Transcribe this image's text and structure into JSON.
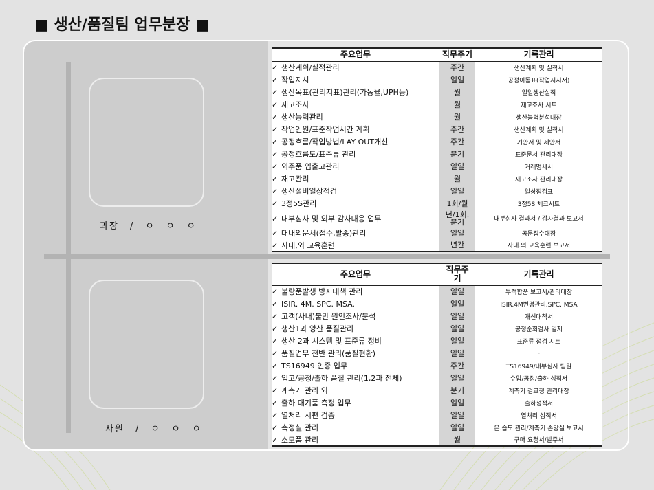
{
  "title": "■ 생산/품질팀 업무분장 ■",
  "headers": {
    "task": "주요업무",
    "cycle": "직무주기",
    "record": "기록관리"
  },
  "headers2": {
    "task": "주요업무",
    "cycle": "직무주기",
    "record": "기록관리"
  },
  "check": "✓",
  "manager": {
    "role": "과장 / ㅇ ㅇ ㅇ"
  },
  "staff": {
    "role": "사원 / ㅇ ㅇ ㅇ"
  },
  "manager_duties": [
    {
      "task": "생산계획/실적관리",
      "cycle": "주간",
      "record": "생산계획 및 실적서"
    },
    {
      "task": "작업지시",
      "cycle": "일일",
      "record": "공정이동표(작업지시서)"
    },
    {
      "task": "생산목표(관리지표)관리(가동율,UPH등)",
      "cycle": "월",
      "record": "일일생산실적"
    },
    {
      "task": "재고조사",
      "cycle": "월",
      "record": "재고조사 시트"
    },
    {
      "task": "생산능력관리",
      "cycle": "월",
      "record": "생산능력분석대장"
    },
    {
      "task": "작업인원/표준작업시간 계획",
      "cycle": "주간",
      "record": "생산계획 및 실적서"
    },
    {
      "task": "공정흐름/작업방법/LAY OUT개선",
      "cycle": "주간",
      "record": "기안서 및 제안서"
    },
    {
      "task": "공정흐름도/표준류 관리",
      "cycle": "분기",
      "record": "표준문서 관리대장"
    },
    {
      "task": "외주품 입출고관리",
      "cycle": "일일",
      "record": "거래명세서"
    },
    {
      "task": "재고관리",
      "cycle": "월",
      "record": "재고조사 관리대장"
    },
    {
      "task": "생산설비일상점검",
      "cycle": "일일",
      "record": "일상점검표"
    },
    {
      "task": "3정5S관리",
      "cycle": "1회/월",
      "record": "3정5S 체크시트"
    },
    {
      "task": "내부심사 및 외부 감사대응 업무",
      "cycle": "년/1회.\n분기",
      "record": "내부심사 결과서 / 감사결과 보고서"
    },
    {
      "task": "대내외문서(접수,발송)관리",
      "cycle": "일일",
      "record": "공문접수대장"
    },
    {
      "task": "사내,외 교육훈련",
      "cycle": "년간",
      "record": "사내.외 교육훈련 보고서"
    }
  ],
  "staff_duties": [
    {
      "task": "불량품발생 방지대책 관리",
      "cycle": "일일",
      "record": "부적합품 보고서/관리대장"
    },
    {
      "task": "ISIR. 4M. SPC. MSA.",
      "cycle": "일일",
      "record": "ISIR.4M변경관리.SPC. MSA"
    },
    {
      "task": "고객(사내)불만 원인조사/분석",
      "cycle": "일일",
      "record": "개선대책서"
    },
    {
      "task": "생산1과 양산 품질관리",
      "cycle": "일일",
      "record": "공정순회검사 일지"
    },
    {
      "task": "생산 2과 시스템  및 표준류 정비",
      "cycle": "일일",
      "record": "표준류 점검 시트"
    },
    {
      "task": "품질업무 전반 관리(품질현황)",
      "cycle": "일일",
      "record": "-"
    },
    {
      "task": "TS16949 인증 업무",
      "cycle": "주간",
      "record": "TS16949/내부심사 팀원"
    },
    {
      "task": "입고/공정/출하 품질 관리(1,2과 전체)",
      "cycle": "일일",
      "record": "수입/공정/출하 성적서"
    },
    {
      "task": "계측기 관리 외",
      "cycle": "분기",
      "record": "계측기 검교정 관리대장"
    },
    {
      "task": "출하 대기품 측정 업무",
      "cycle": "일일",
      "record": "출하성적서"
    },
    {
      "task": "열처리 시편 검증",
      "cycle": "일일",
      "record": "열처리 성적서"
    },
    {
      "task": "측정실 관리",
      "cycle": "일일",
      "record": "온.습도 관리/계측기 손망실 보고서"
    },
    {
      "task": "소모품 관리",
      "cycle": "월",
      "record": "구매 요청서/발주서"
    }
  ]
}
